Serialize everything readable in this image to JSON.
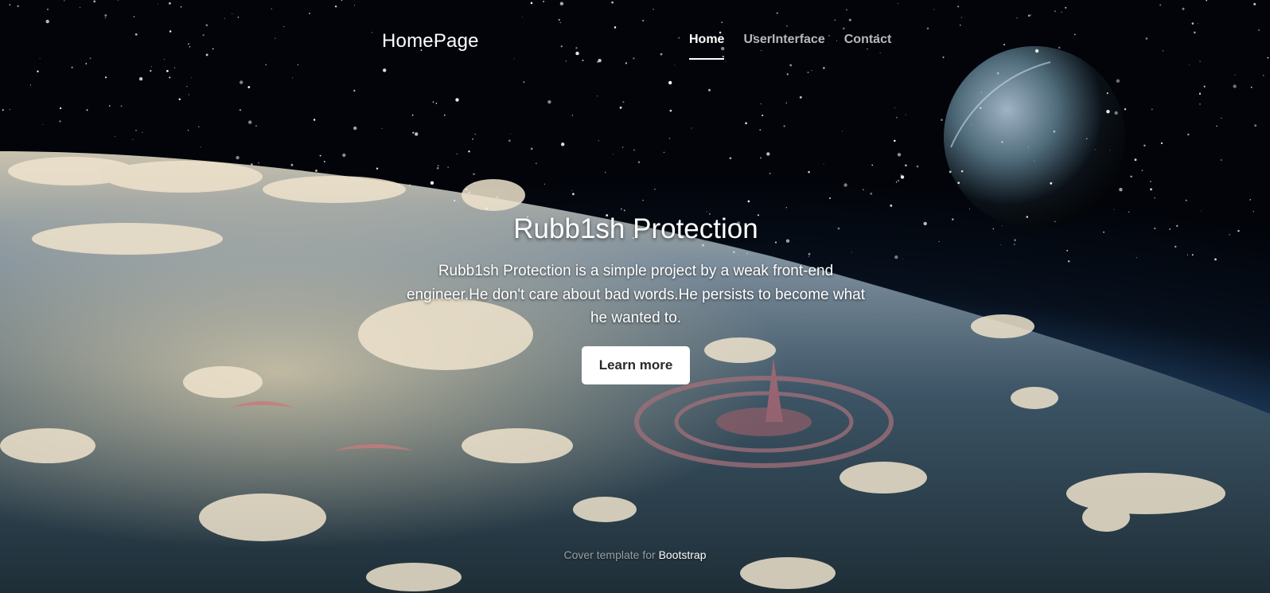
{
  "header": {
    "brand": "HomePage",
    "nav": [
      {
        "label": "Home",
        "active": true
      },
      {
        "label": "UserInterface",
        "active": false
      },
      {
        "label": "Contact",
        "active": false
      }
    ]
  },
  "hero": {
    "title": "Rubb1sh Protection",
    "lead_line1": "Rubb1sh Protection is a simple project by a weak front-end",
    "lead_line2": "engineer.He don't care about bad words.He persists to become what",
    "lead_line3": "he wanted to.",
    "button_label": "Learn more"
  },
  "footer": {
    "text": "Cover template for",
    "link_label": "Bootstrap"
  },
  "colors": {
    "text": "#ffffff",
    "button_bg": "#ffffff",
    "button_text": "#2a2a2a",
    "space": "#03060d",
    "atmosphere": "#4b8fc4"
  }
}
